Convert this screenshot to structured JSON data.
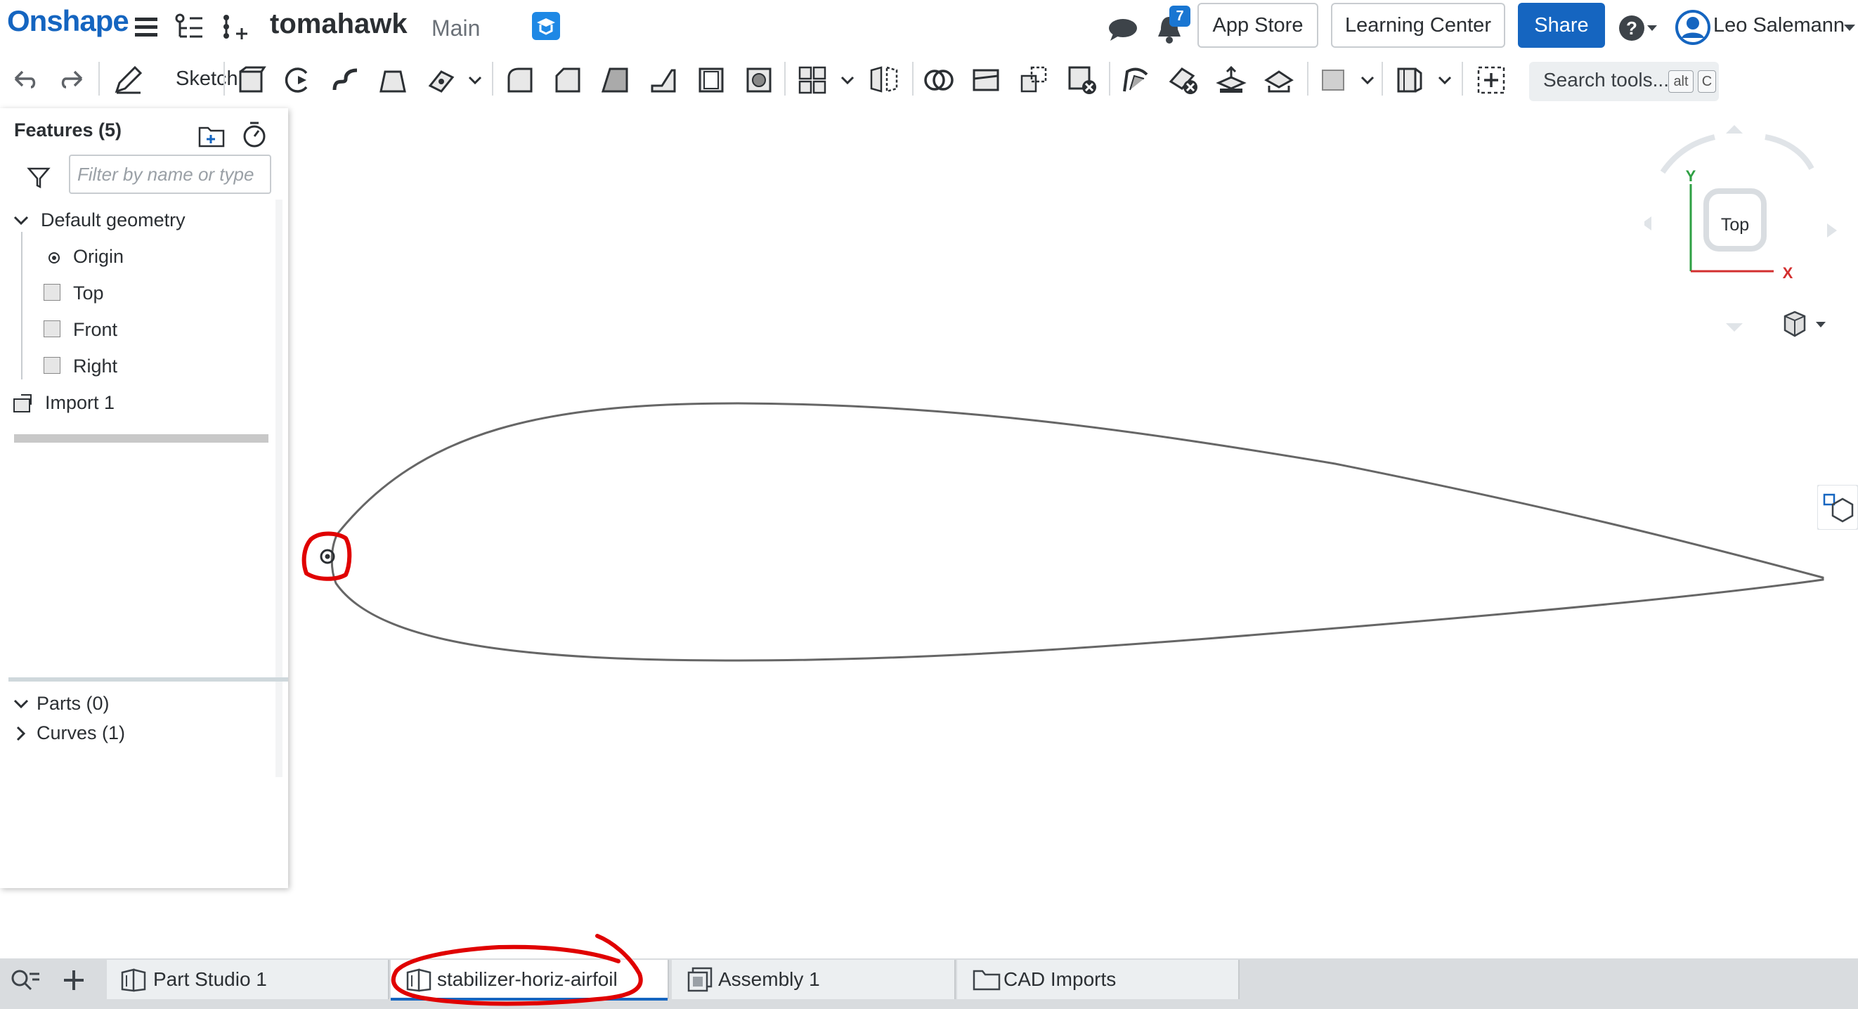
{
  "app": {
    "logo": "Onshape"
  },
  "document": {
    "name": "tomahawk",
    "branch": "Main"
  },
  "header": {
    "notification_count": "7",
    "app_store_label": "App Store",
    "learning_center_label": "Learning Center",
    "share_label": "Share",
    "help_icon": "?",
    "user_name": "Leo Salemann"
  },
  "toolbar": {
    "sketch_label": "Sketch",
    "search_label": "Search tools...",
    "shortcut_key1": "alt",
    "shortcut_key2": "C"
  },
  "features": {
    "title": "Features (5)",
    "filter_placeholder": "Filter by name or type",
    "tree": [
      {
        "label": "Default geometry",
        "type": "group"
      },
      {
        "label": "Origin",
        "type": "origin"
      },
      {
        "label": "Top",
        "type": "plane"
      },
      {
        "label": "Front",
        "type": "plane"
      },
      {
        "label": "Right",
        "type": "plane"
      },
      {
        "label": "Import 1",
        "type": "import"
      }
    ],
    "parts_label": "Parts (0)",
    "curves_label": "Curves (1)"
  },
  "view_cube": {
    "face_label": "Top",
    "axis_y": "Y",
    "axis_x": "X"
  },
  "tabs": [
    {
      "label": "Part Studio 1",
      "icon": "part-studio-icon",
      "active": false
    },
    {
      "label": "stabilizer-horiz-airfoil",
      "icon": "part-studio-icon",
      "active": true
    },
    {
      "label": "Assembly 1",
      "icon": "assembly-icon",
      "active": false
    },
    {
      "label": "CAD Imports",
      "icon": "folder-icon",
      "active": false
    }
  ],
  "colors": {
    "brand": "#1565c0",
    "annotation": "#e00000",
    "curve": "#666666"
  }
}
